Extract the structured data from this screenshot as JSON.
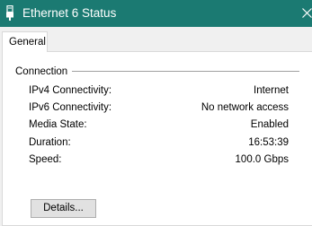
{
  "window": {
    "title": "Ethernet 6 Status",
    "title_icon": "network-adapter-icon",
    "close_icon": "close-icon"
  },
  "tabs": [
    {
      "label": "General",
      "selected": true
    }
  ],
  "connection": {
    "group_title": "Connection",
    "rows": [
      {
        "label": "IPv4 Connectivity:",
        "value": "Internet"
      },
      {
        "label": "IPv6 Connectivity:",
        "value": "No network access"
      },
      {
        "label": "Media State:",
        "value": "Enabled"
      },
      {
        "label": "Duration:",
        "value": "16:53:39"
      },
      {
        "label": "Speed:",
        "value": "100.0 Gbps"
      }
    ]
  },
  "buttons": {
    "details_label": "Details..."
  },
  "colors": {
    "titlebar": "#1b7a72",
    "dialog_background": "#f0f0f0",
    "panel_background": "#ffffff"
  }
}
